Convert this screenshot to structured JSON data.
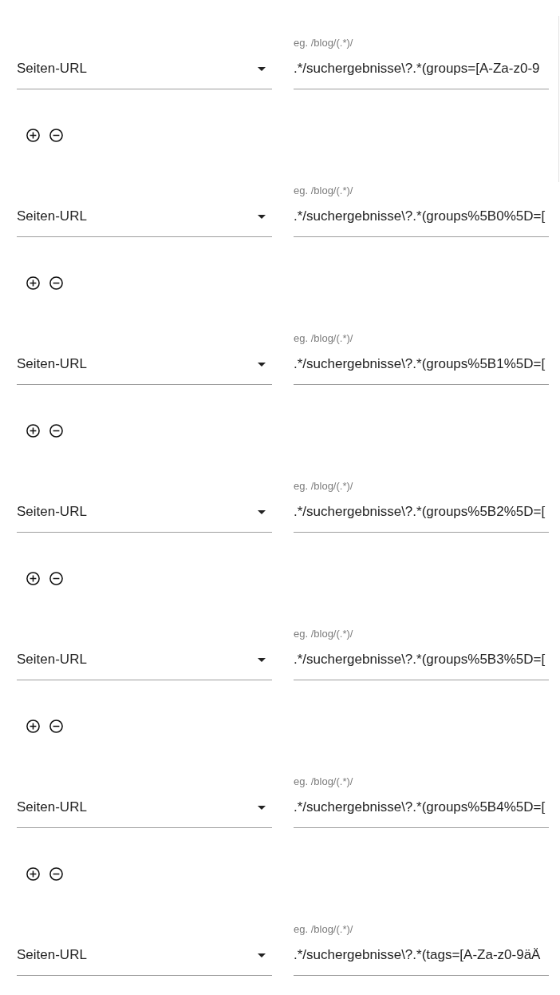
{
  "rules": [
    {
      "match_type": {
        "value": "Seiten-URL"
      },
      "pattern": {
        "label": "eg. /blog/(.*)/",
        "value": ".*/suchergebnisse\\?.*(groups=[A-Za-z0-9"
      },
      "actions": [
        {
          "kind": "add"
        },
        {
          "kind": "remove"
        }
      ]
    },
    {
      "match_type": {
        "value": "Seiten-URL"
      },
      "pattern": {
        "label": "eg. /blog/(.*)/",
        "value": ".*/suchergebnisse\\?.*(groups%5B0%5D=["
      },
      "actions": [
        {
          "kind": "add"
        },
        {
          "kind": "remove"
        }
      ]
    },
    {
      "match_type": {
        "value": "Seiten-URL"
      },
      "pattern": {
        "label": "eg. /blog/(.*)/",
        "value": ".*/suchergebnisse\\?.*(groups%5B1%5D=["
      },
      "actions": [
        {
          "kind": "add"
        },
        {
          "kind": "remove"
        }
      ]
    },
    {
      "match_type": {
        "value": "Seiten-URL"
      },
      "pattern": {
        "label": "eg. /blog/(.*)/",
        "value": ".*/suchergebnisse\\?.*(groups%5B2%5D=["
      },
      "actions": [
        {
          "kind": "add"
        },
        {
          "kind": "remove"
        }
      ]
    },
    {
      "match_type": {
        "value": "Seiten-URL"
      },
      "pattern": {
        "label": "eg. /blog/(.*)/",
        "value": ".*/suchergebnisse\\?.*(groups%5B3%5D=["
      },
      "actions": [
        {
          "kind": "add"
        },
        {
          "kind": "remove"
        }
      ]
    },
    {
      "match_type": {
        "value": "Seiten-URL"
      },
      "pattern": {
        "label": "eg. /blog/(.*)/",
        "value": ".*/suchergebnisse\\?.*(groups%5B4%5D=["
      },
      "actions": [
        {
          "kind": "add"
        },
        {
          "kind": "remove"
        }
      ]
    },
    {
      "match_type": {
        "value": "Seiten-URL"
      },
      "pattern": {
        "label": "eg. /blog/(.*)/",
        "value": ".*/suchergebnisse\\?.*(tags=[A-Za-z0-9äÄ"
      }
    }
  ]
}
